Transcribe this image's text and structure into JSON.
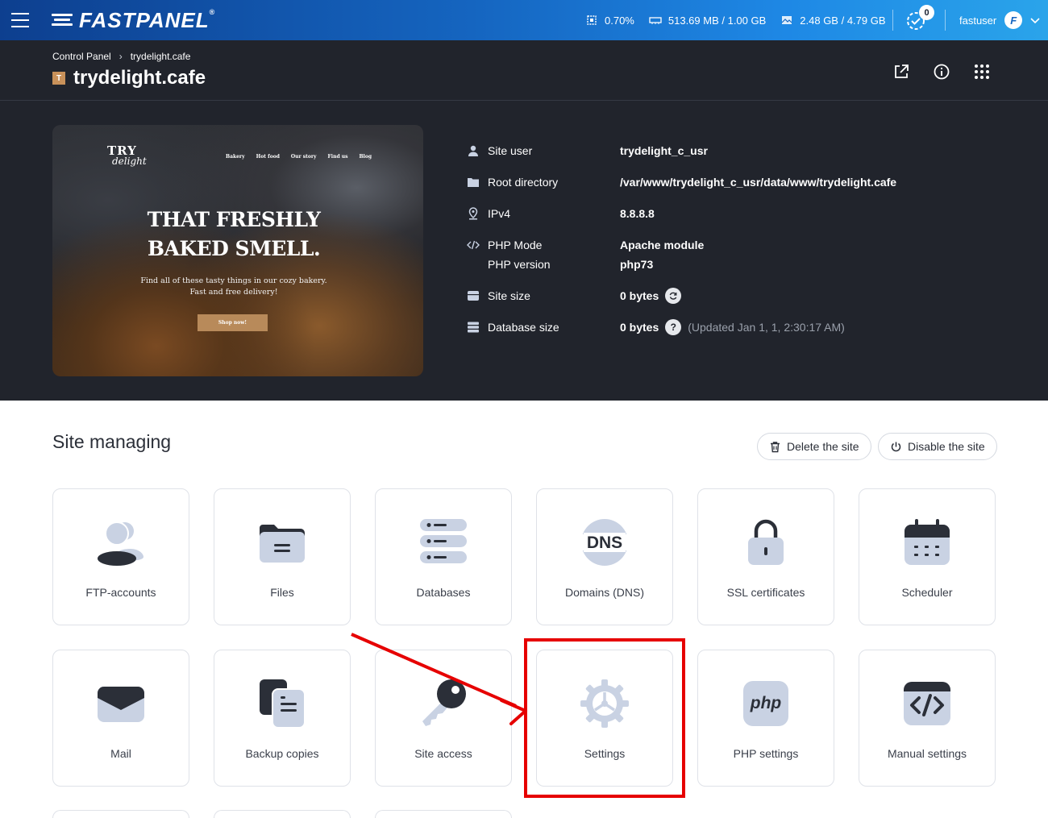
{
  "topbar": {
    "brand": "FASTPANEL",
    "brand_reg": "®",
    "cpu": "0.70%",
    "ram": "513.69 MB / 1.00 GB",
    "disk": "2.48 GB / 4.79 GB",
    "tasks_count": "0",
    "username": "fastuser",
    "avatar_letter": "F"
  },
  "breadcrumb": {
    "root": "Control Panel",
    "sep": "›",
    "current": "trydelight.cafe"
  },
  "site": {
    "favicon_letter": "T",
    "title": "trydelight.cafe"
  },
  "preview": {
    "logo_top": "TRY",
    "logo_bottom": "delight",
    "nav": [
      "Bakery",
      "Hot food",
      "Our story",
      "Find us",
      "Blog"
    ],
    "headline_1": "THAT FRESHLY",
    "headline_2": "BAKED SMELL.",
    "sub_1": "Find all of these tasty things in our cozy bakery.",
    "sub_2": "Fast and free delivery!",
    "button": "Shop now!"
  },
  "info": {
    "site_user_label": "Site user",
    "site_user_value": "trydelight_c_usr",
    "root_label": "Root directory",
    "root_value": "/var/www/trydelight_c_usr/data/www/trydelight.cafe",
    "ipv4_label": "IPv4",
    "ipv4_value": "8.8.8.8",
    "php_mode_label": "PHP Mode",
    "php_mode_value": "Apache module",
    "php_version_label": "PHP version",
    "php_version_value": "php73",
    "site_size_label": "Site size",
    "site_size_value": "0 bytes",
    "db_size_label": "Database size",
    "db_size_value": "0 bytes",
    "db_help": "?",
    "db_updated": "(Updated Jan 1, 1, 2:30:17 AM)"
  },
  "managing": {
    "title": "Site managing",
    "delete_label": "Delete the site",
    "disable_label": "Disable the site",
    "tiles": [
      {
        "label": "FTP-accounts",
        "icon": "users-icon"
      },
      {
        "label": "Files",
        "icon": "folder-icon"
      },
      {
        "label": "Databases",
        "icon": "database-icon"
      },
      {
        "label": "Domains (DNS)",
        "icon": "dns-icon",
        "icon_text": "DNS"
      },
      {
        "label": "SSL certificates",
        "icon": "lock-icon"
      },
      {
        "label": "Scheduler",
        "icon": "calendar-icon"
      },
      {
        "label": "Mail",
        "icon": "mail-icon"
      },
      {
        "label": "Backup copies",
        "icon": "backup-icon"
      },
      {
        "label": "Site access",
        "icon": "key-icon"
      },
      {
        "label": "Settings",
        "icon": "gear-icon"
      },
      {
        "label": "PHP settings",
        "icon": "php-icon",
        "icon_text": "php"
      },
      {
        "label": "Manual settings",
        "icon": "code-icon"
      }
    ]
  },
  "colors": {
    "topbar_start": "#0d3f8f",
    "topbar_end": "#2aa4ea",
    "dark_bg": "#21242c",
    "icon_fill": "#c9d2e3",
    "icon_dark": "#2b2f38",
    "annotation": "#e60000"
  }
}
